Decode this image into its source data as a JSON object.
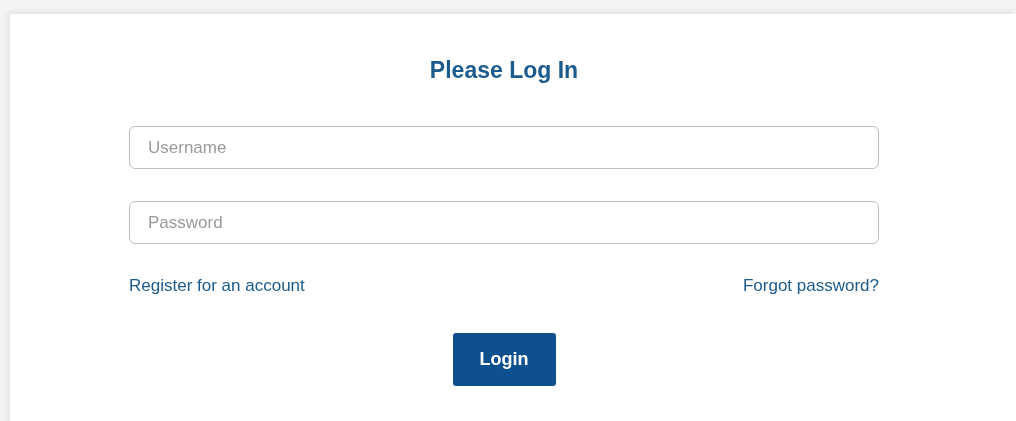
{
  "title": "Please Log In",
  "fields": [
    {
      "placeholder": "Username"
    },
    {
      "placeholder": "Password"
    }
  ],
  "links": [
    "Register for an account",
    "Forgot password?"
  ],
  "button": "Login"
}
